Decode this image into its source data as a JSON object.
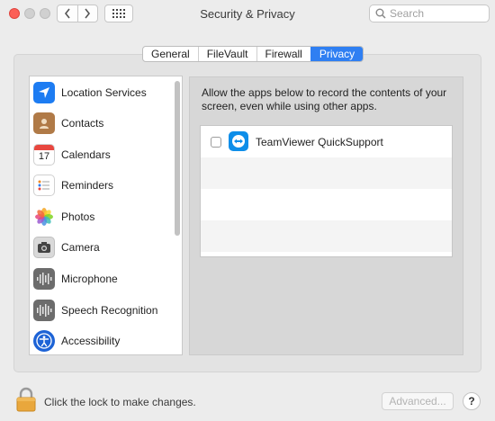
{
  "window": {
    "title": "Security & Privacy"
  },
  "search": {
    "placeholder": "Search"
  },
  "tabs": [
    {
      "label": "General",
      "active": false
    },
    {
      "label": "FileVault",
      "active": false
    },
    {
      "label": "Firewall",
      "active": false
    },
    {
      "label": "Privacy",
      "active": true
    }
  ],
  "sidebar": {
    "items": [
      {
        "label": "Location Services",
        "icon": "location-arrow-icon"
      },
      {
        "label": "Contacts",
        "icon": "contacts-book-icon"
      },
      {
        "label": "Calendars",
        "icon": "calendar-icon",
        "icon_text": "17"
      },
      {
        "label": "Reminders",
        "icon": "reminders-list-icon"
      },
      {
        "label": "Photos",
        "icon": "photos-flower-icon"
      },
      {
        "label": "Camera",
        "icon": "camera-icon"
      },
      {
        "label": "Microphone",
        "icon": "waveform-icon"
      },
      {
        "label": "Speech Recognition",
        "icon": "waveform-icon"
      },
      {
        "label": "Accessibility",
        "icon": "accessibility-icon"
      }
    ]
  },
  "content": {
    "description": "Allow the apps below to record the contents of your screen, even while using other apps.",
    "apps": [
      {
        "name": "TeamViewer QuickSupport",
        "checked": false
      }
    ]
  },
  "footer": {
    "lock_text": "Click the lock to make changes.",
    "advanced_label": "Advanced...",
    "help_label": "?"
  },
  "colors": {
    "accent": "#2f7ff2",
    "close": "#fc5f57",
    "teamviewer": "#0e8ee9"
  }
}
